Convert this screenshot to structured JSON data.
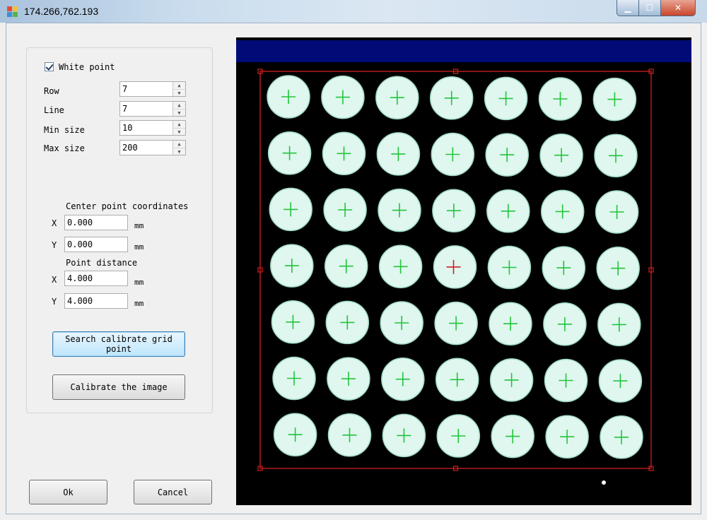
{
  "window": {
    "title": "174.266,762.193",
    "controls": {
      "minimize": "▁",
      "maximize": "☐",
      "close": "✕"
    }
  },
  "params": {
    "white_point_label": "White point",
    "white_point_checked": true,
    "row_label": "Row",
    "row_value": "7",
    "line_label": "Line",
    "line_value": "7",
    "min_size_label": "Min size",
    "min_size_value": "10",
    "max_size_label": "Max size",
    "max_size_value": "200"
  },
  "center_point": {
    "heading": "Center point coordinates",
    "x_label": "X",
    "x_value": "0.000",
    "y_label": "Y",
    "y_value": "0.000",
    "unit": "mm"
  },
  "point_distance": {
    "heading": "Point distance",
    "x_label": "X",
    "x_value": "4.000",
    "y_label": "Y",
    "y_value": "4.000",
    "unit": "mm"
  },
  "buttons": {
    "search_line1": "Search calibrate grid",
    "search_line2": "point",
    "calibrate": "Calibrate the image",
    "ok": "Ok",
    "cancel": "Cancel"
  },
  "image": {
    "grid_rows": 7,
    "grid_cols": 7,
    "dot_color": "#dff7ef",
    "cross_color": "#22c43a",
    "highlight_cross_color": "#d42020",
    "roi_color": "#d02020",
    "banner_color": "#000b78"
  }
}
